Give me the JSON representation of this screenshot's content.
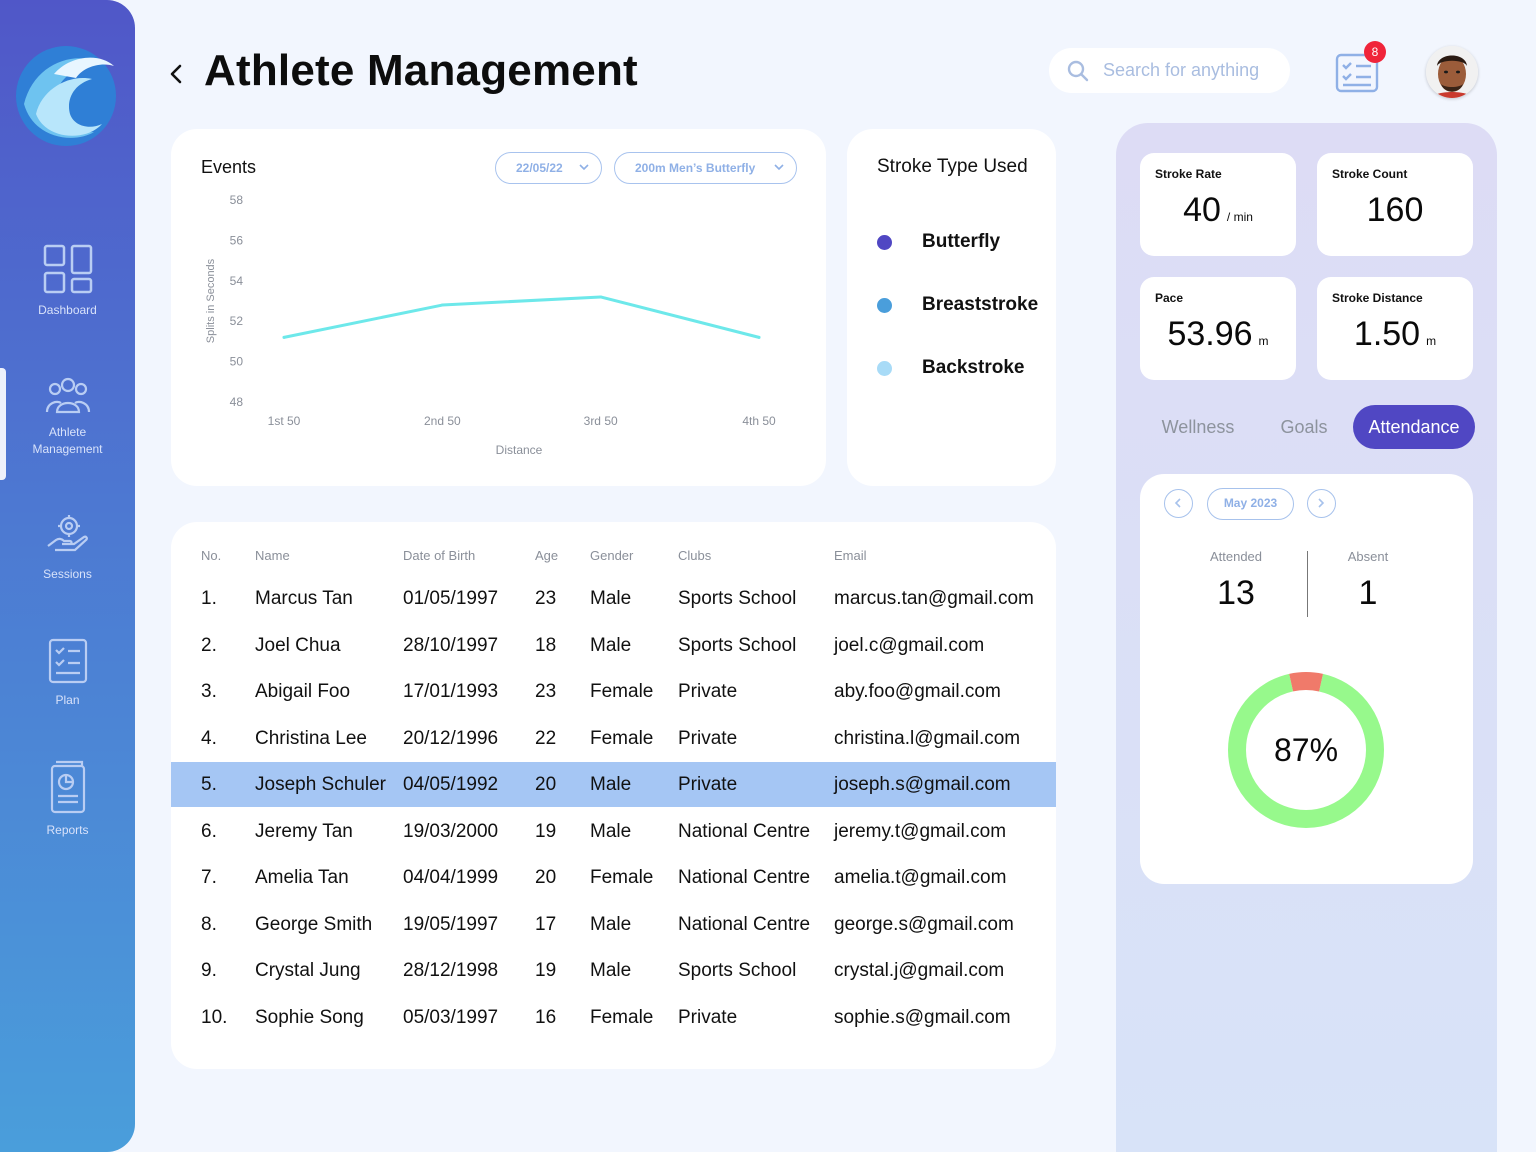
{
  "sidebar": {
    "items": [
      {
        "label": "Dashboard",
        "icon": "dashboard-icon"
      },
      {
        "label": "Athlete\nManagement",
        "icon": "team-icon"
      },
      {
        "label": "Sessions",
        "icon": "sessions-icon"
      },
      {
        "label": "Plan",
        "icon": "plan-icon"
      },
      {
        "label": "Reports",
        "icon": "reports-icon"
      }
    ]
  },
  "header": {
    "title": "Athlete Management",
    "search_placeholder": "Search for anything",
    "notification_count": "8"
  },
  "events": {
    "title": "Events",
    "date_filter": "22/05/22",
    "event_filter": "200m Men’s Butterfly"
  },
  "chart_data": {
    "type": "line",
    "categories": [
      "1st 50",
      "2nd 50",
      "3rd 50",
      "4th 50"
    ],
    "series": [
      {
        "values": [
          51.2,
          52.8,
          53.2,
          51.2
        ],
        "color": "#6de8ea"
      }
    ],
    "xlabel": "Distance",
    "ylabel": "Splits in Seconds",
    "ylim": [
      48,
      58
    ],
    "yticks": [
      "48",
      "50",
      "52",
      "54",
      "56",
      "58"
    ],
    "grid": false
  },
  "stroke_types": {
    "title": "Stroke Type Used",
    "items": [
      {
        "label": "Butterfly",
        "color": "#5047c3"
      },
      {
        "label": "Breaststroke",
        "color": "#4a9edb"
      },
      {
        "label": "Backstroke",
        "color": "#a8dbf7"
      }
    ]
  },
  "table": {
    "headers": [
      "No.",
      "Name",
      "Date of Birth",
      "Age",
      "Gender",
      "Clubs",
      "Email"
    ],
    "rows": [
      [
        "1.",
        "Marcus Tan",
        "01/05/1997",
        "23",
        "Male",
        "Sports School",
        "marcus.tan@gmail.com"
      ],
      [
        "2.",
        "Joel Chua",
        "28/10/1997",
        "18",
        "Male",
        "Sports School",
        "joel.c@gmail.com"
      ],
      [
        "3.",
        "Abigail Foo",
        "17/01/1993",
        "23",
        "Female",
        "Private",
        "aby.foo@gmail.com"
      ],
      [
        "4.",
        "Christina Lee",
        "20/12/1996",
        "22",
        "Female",
        "Private",
        "christina.l@gmail.com"
      ],
      [
        "5.",
        "Joseph Schuler",
        "04/05/1992",
        "20",
        "Male",
        "Private",
        "joseph.s@gmail.com"
      ],
      [
        "6.",
        "Jeremy Tan",
        "19/03/2000",
        "19",
        "Male",
        "National Centre",
        "jeremy.t@gmail.com"
      ],
      [
        "7.",
        "Amelia Tan",
        "04/04/1999",
        "20",
        "Female",
        "National Centre",
        "amelia.t@gmail.com"
      ],
      [
        "8.",
        "George Smith",
        "19/05/1997",
        "17",
        "Male",
        "National Centre",
        "george.s@gmail.com"
      ],
      [
        "9.",
        "Crystal Jung",
        "28/12/1998",
        "19",
        "Male",
        "Sports School",
        "crystal.j@gmail.com"
      ],
      [
        "10.",
        "Sophie Song",
        "05/03/1997",
        "16",
        "Female",
        "Private",
        "sophie.s@gmail.com"
      ]
    ],
    "selected_row": 4
  },
  "stats": {
    "stroke_rate": {
      "label": "Stroke Rate",
      "value": "40",
      "unit": "/ min"
    },
    "stroke_count": {
      "label": "Stroke Count",
      "value": "160",
      "unit": ""
    },
    "pace": {
      "label": "Pace",
      "value": "53.96",
      "unit": "m"
    },
    "stroke_distance": {
      "label": "Stroke Distance",
      "value": "1.50",
      "unit": "m"
    }
  },
  "tabs": [
    "Wellness",
    "Goals",
    "Attendance"
  ],
  "active_tab": "Attendance",
  "attendance": {
    "month": "May 2023",
    "attended_label": "Attended",
    "attended": "13",
    "absent_label": "Absent",
    "absent": "1",
    "percent_label": "87%",
    "attended_fraction": 0.93,
    "attended_color": "#97f98c",
    "absent_color": "#f07a6a"
  }
}
